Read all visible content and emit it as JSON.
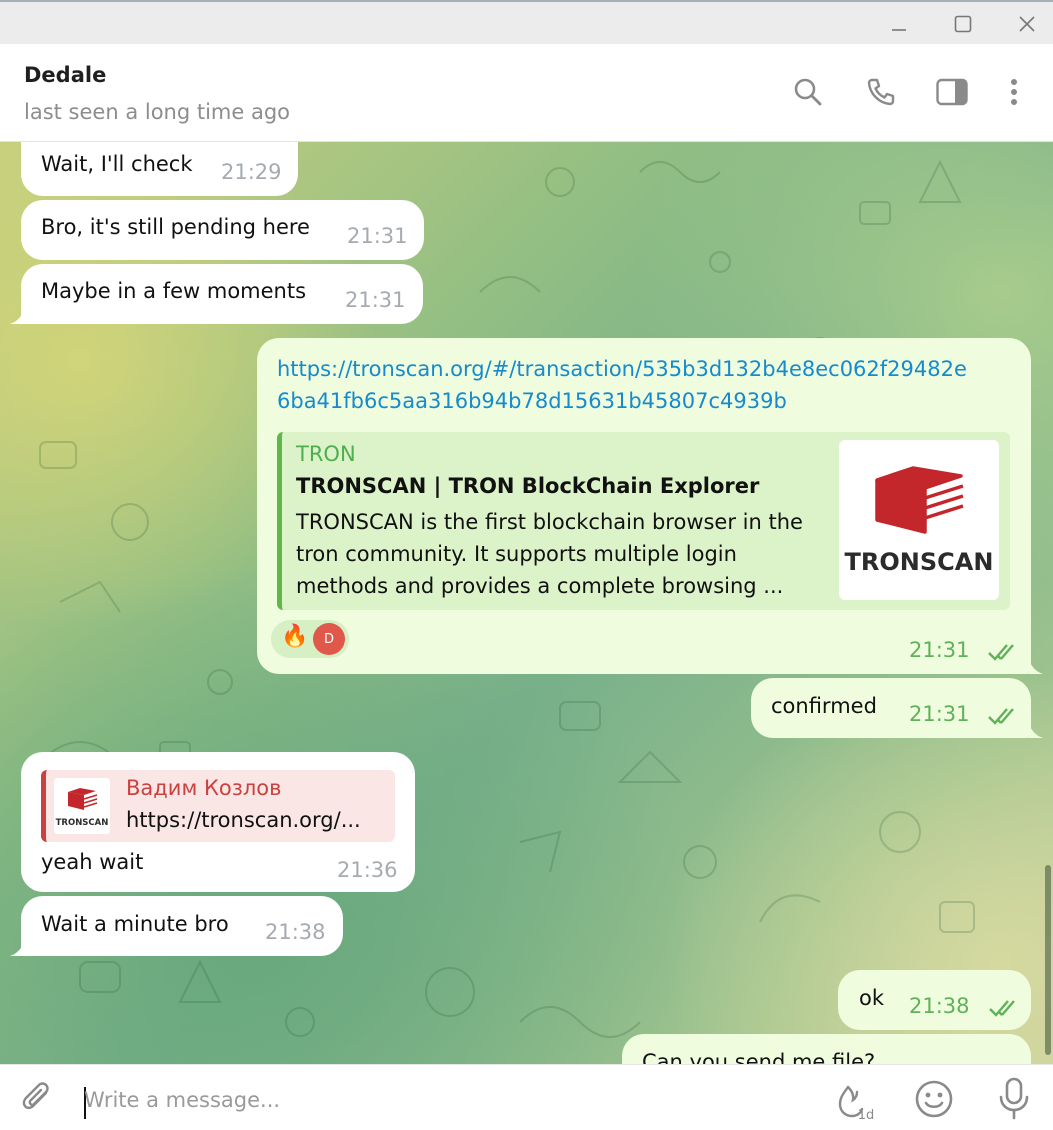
{
  "window": {
    "minimize_icon": "minimize-icon",
    "maximize_icon": "maximize-icon",
    "close_icon": "close-icon"
  },
  "header": {
    "name": "Dedale",
    "status": "last seen a long time ago",
    "icons": [
      "search-icon",
      "phone-icon",
      "sidebar-icon",
      "more-vertical-icon"
    ]
  },
  "messages": [
    {
      "dir": "in",
      "text": "Wait, I'll check",
      "time": "21:29"
    },
    {
      "dir": "in",
      "text": "Bro, it's still pending here",
      "time": "21:31"
    },
    {
      "dir": "in",
      "text": "Maybe in a few moments",
      "time": "21:31"
    },
    {
      "dir": "out",
      "link_line1": "https://tronscan.org/#/transaction/535b3d132b4e8ec062f29482e",
      "link_line2": "6ba41fb6c5aa316b94b78d15631b45807c4939b",
      "preview": {
        "site": "TRON",
        "title": "TRONSCAN | TRON BlockChain Explorer",
        "description": "TRONSCAN is the first blockchain browser in the tron community. It supports multiple login methods and provides a complete browsing ...",
        "thumb_text": "TRONSCAN"
      },
      "reaction_emoji": "🔥",
      "reaction_avatar": "D",
      "time": "21:31",
      "status": "read"
    },
    {
      "dir": "out",
      "text": "confirmed",
      "time": "21:31",
      "status": "read"
    },
    {
      "dir": "in",
      "reply": {
        "name": "Вадим Козлов",
        "text": "https://tronscan.org/...",
        "thumb_text": "TRONSCAN"
      },
      "text": "yeah wait",
      "time": "21:36"
    },
    {
      "dir": "in",
      "text": "Wait a minute bro",
      "time": "21:38"
    },
    {
      "dir": "out",
      "text": "ok",
      "time": "21:38",
      "status": "read"
    },
    {
      "dir": "out",
      "text": "Can you send me file?",
      "partial": true
    }
  ],
  "composer": {
    "placeholder": "Write a message...",
    "timer_label": "1d",
    "icons": [
      "attach-icon",
      "self-destruct-timer-icon",
      "emoji-icon",
      "microphone-icon"
    ]
  },
  "colors": {
    "outgoing_bubble": "#effdde",
    "incoming_bubble": "#ffffff",
    "link": "#168acd",
    "outgoing_time": "#5fb15a",
    "reply_accent": "#c9423f",
    "preview_accent": "#5fb84a",
    "tronscan_red": "#c3272b"
  }
}
